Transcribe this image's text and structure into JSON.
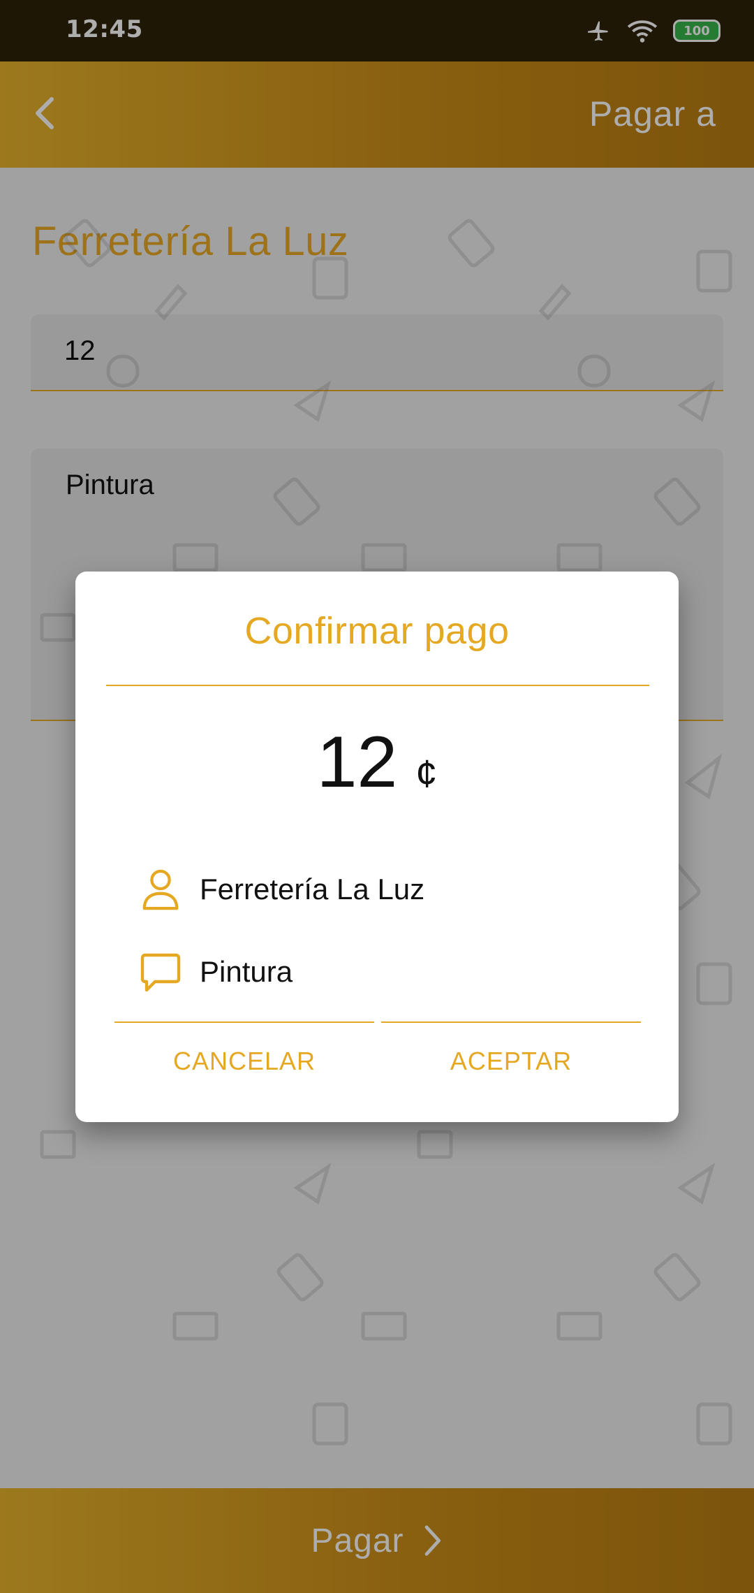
{
  "status_bar": {
    "time": "12:45",
    "battery": "100",
    "icons": [
      "airplane-icon",
      "wifi-icon",
      "battery-icon"
    ]
  },
  "app_bar": {
    "title": "Pagar a",
    "back_icon": "chevron-left-icon"
  },
  "form": {
    "merchant_name": "Ferretería La Luz",
    "amount_value": "12",
    "description_value": "Pintura"
  },
  "pay_bar": {
    "label": "Pagar",
    "icon": "chevron-right-icon"
  },
  "dialog": {
    "title": "Confirmar pago",
    "amount": "12",
    "currency_symbol": "¢",
    "recipient": "Ferretería La Luz",
    "recipient_icon": "person-icon",
    "note": "Pintura",
    "note_icon": "chat-bubble-icon",
    "cancel_label": "CANCELAR",
    "accept_label": "ACEPTAR"
  },
  "colors": {
    "accent": "#e5a823",
    "appbar_start": "#e7b22c",
    "appbar_end": "#b77c11",
    "statusbar": "#2e2208",
    "scrim": "rgba(0,0,0,0.32)"
  }
}
